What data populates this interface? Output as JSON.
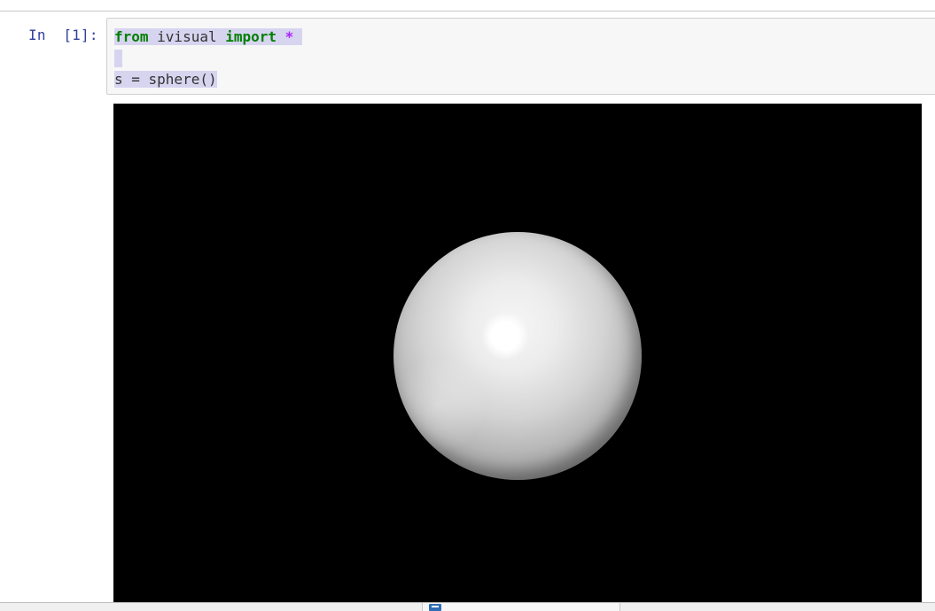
{
  "cell": {
    "prompt": "In  [1]:",
    "lines": {
      "line1": {
        "kw_from": "from",
        "module": " ivisual ",
        "kw_import": "import",
        "space": " ",
        "star": "*",
        "trail": " "
      },
      "line3": "s = sphere()"
    }
  },
  "output": {
    "scene": "sphere",
    "background_color": "#000000",
    "object_color": "#ffffff"
  },
  "colors": {
    "prompt": "#303f9f",
    "keyword": "#008000",
    "operator": "#aa22ff",
    "selection": "#d7d4f0"
  },
  "taskbar": {
    "icon": "window-icon"
  }
}
